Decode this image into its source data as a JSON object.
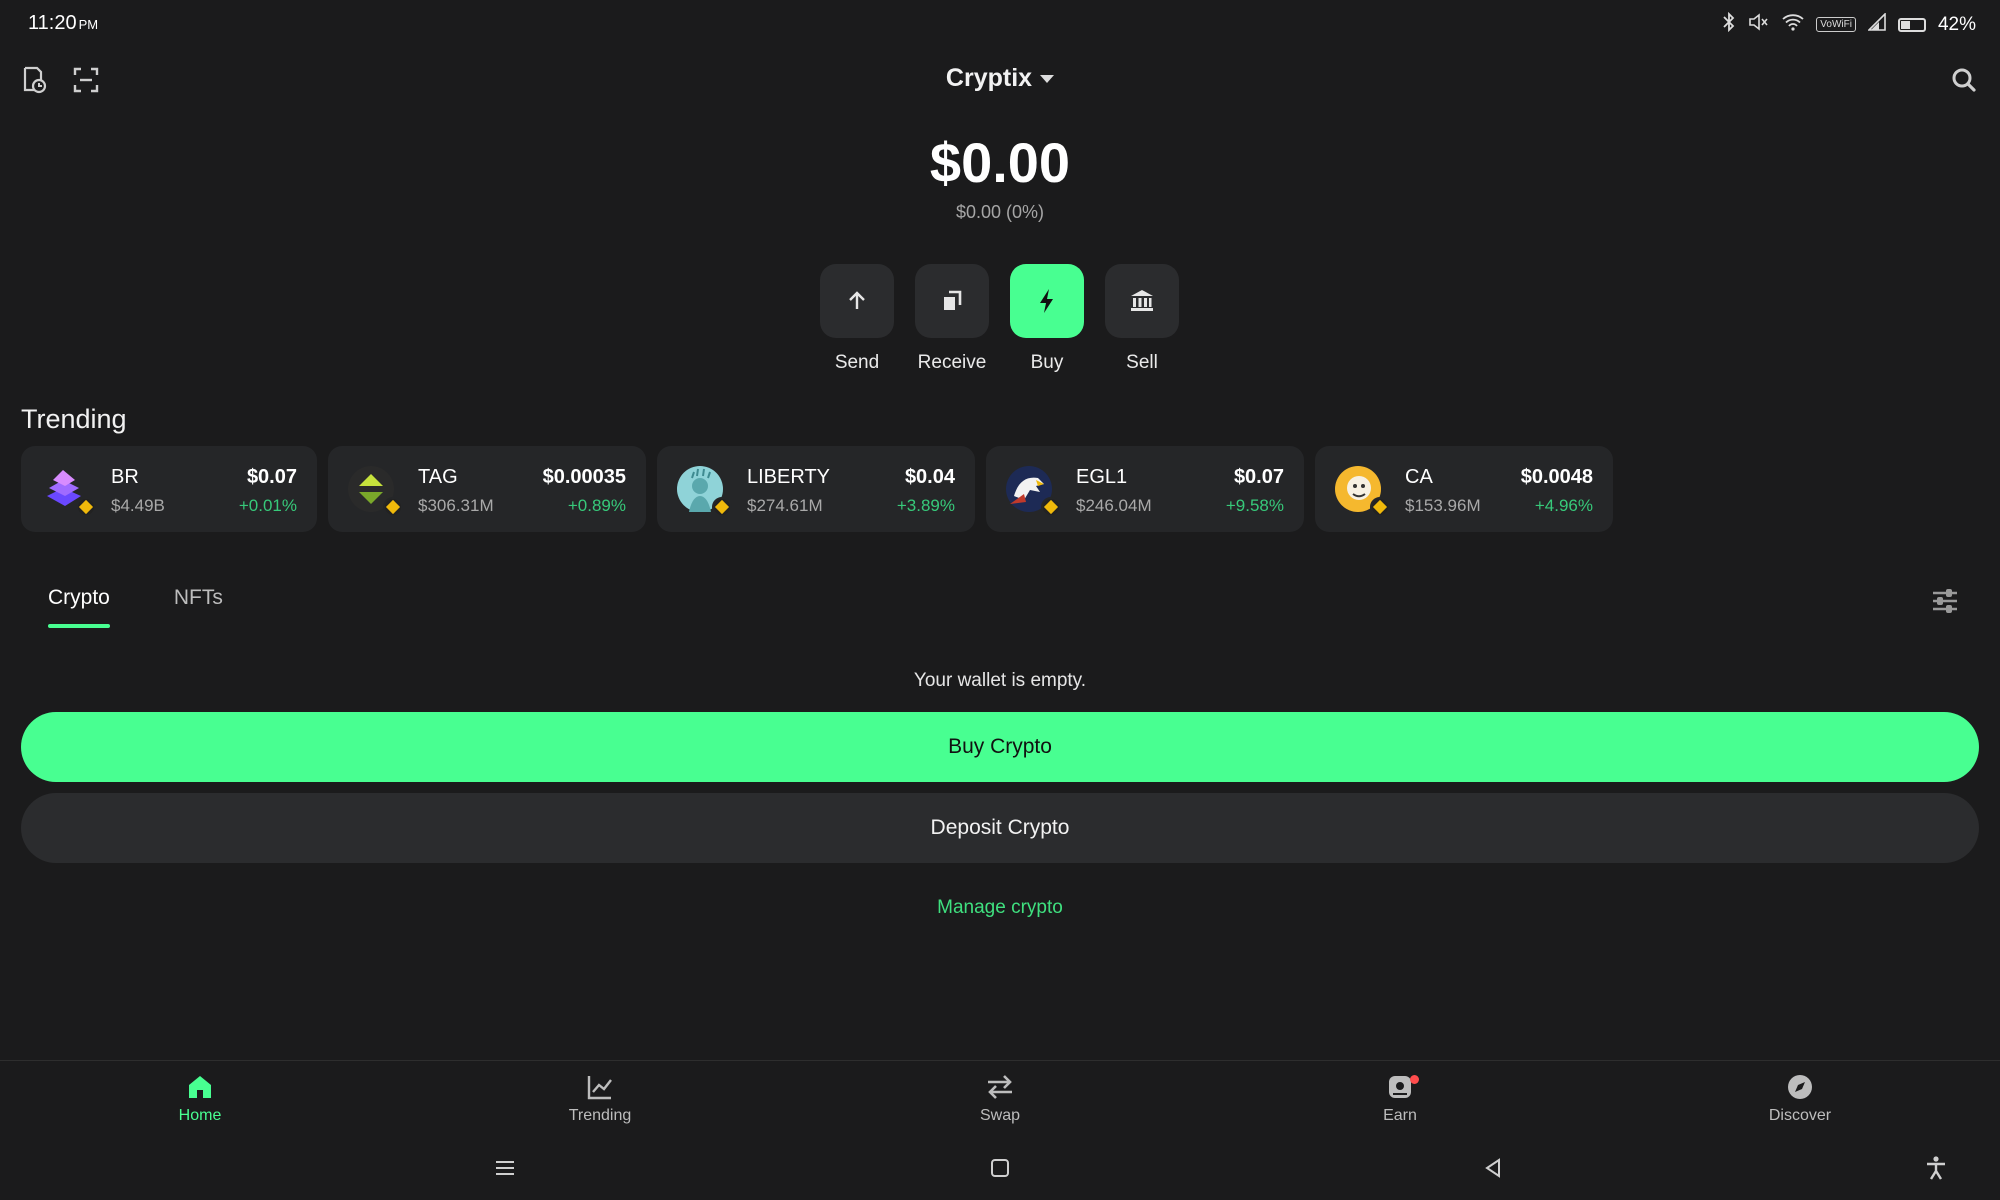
{
  "status_bar": {
    "time": "11:20",
    "ampm": "PM",
    "volte": "VoWiFi",
    "battery_pct": "42%"
  },
  "header": {
    "wallet_name": "Cryptix"
  },
  "balance": {
    "total": "$0.00",
    "change": "$0.00 (0%)"
  },
  "actions": [
    {
      "label": "Send",
      "icon": "arrow-up-icon"
    },
    {
      "label": "Receive",
      "icon": "copy-icon"
    },
    {
      "label": "Buy",
      "icon": "lightning-icon"
    },
    {
      "label": "Sell",
      "icon": "bank-icon"
    }
  ],
  "trending": {
    "title": "Trending",
    "tokens": [
      {
        "symbol": "BR",
        "market_cap": "$4.49B",
        "price": "$0.07",
        "change": "+0.01%",
        "color": "#7b5cff"
      },
      {
        "symbol": "TAG",
        "market_cap": "$306.31M",
        "price": "$0.00035",
        "change": "+0.89%",
        "color": "#9acd32"
      },
      {
        "symbol": "LIBERTY",
        "market_cap": "$274.61M",
        "price": "$0.04",
        "change": "+3.89%",
        "color": "#8fd3d8"
      },
      {
        "symbol": "EGL1",
        "market_cap": "$246.04M",
        "price": "$0.07",
        "change": "+9.58%",
        "color": "#c0392b"
      },
      {
        "symbol": "CA",
        "market_cap": "$153.96M",
        "price": "$0.0048",
        "change": "+4.96%",
        "color": "#f5b82e"
      }
    ]
  },
  "tabs": [
    {
      "label": "Crypto",
      "active": true
    },
    {
      "label": "NFTs",
      "active": false
    }
  ],
  "wallet": {
    "empty_message": "Your wallet is empty.",
    "buy_label": "Buy Crypto",
    "deposit_label": "Deposit Crypto",
    "manage_label": "Manage crypto"
  },
  "bottom_nav": [
    {
      "label": "Home",
      "icon": "home-icon",
      "active": true
    },
    {
      "label": "Trending",
      "icon": "chart-icon",
      "active": false
    },
    {
      "label": "Swap",
      "icon": "swap-icon",
      "active": false
    },
    {
      "label": "Earn",
      "icon": "earn-icon",
      "active": false
    },
    {
      "label": "Discover",
      "icon": "compass-icon",
      "active": false
    }
  ],
  "colors": {
    "accent": "#48ff91",
    "background": "#1b1b1c",
    "card": "#252628",
    "positive": "#37c97a"
  }
}
